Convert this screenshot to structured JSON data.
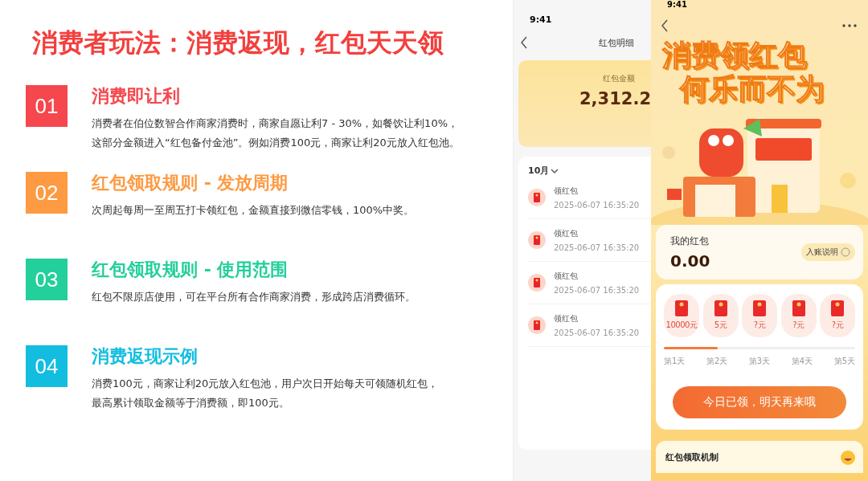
{
  "slide": {
    "title": "消费者玩法：消费返现，红包天天领",
    "points": [
      {
        "number": "01",
        "heading": "消费即让利",
        "color": "#f5474d",
        "body": [
          "消费者在伯位数智合作商家消费时，商家自愿让利7 - 30%，如餐饮让利10%，",
          "这部分金额进入“红包备付金池”。例如消费100元，商家让利20元放入红包池。"
        ]
      },
      {
        "number": "02",
        "heading": "红包领取规则 - 发放周期",
        "color": "#fd9a42",
        "body": [
          "次周起每周一至周五打卡领红包，金额直接到微信零钱，100%中奖。"
        ]
      },
      {
        "number": "03",
        "heading": "红包领取规则 - 使用范围",
        "color": "#23cf9a",
        "body": [
          "红包不限原店使用，可在平台所有合作商家消费，形成跨店消费循环。"
        ]
      },
      {
        "number": "04",
        "heading": "消费返现示例",
        "color": "#12bde0",
        "body": [
          "消费100元，商家让利20元放入红包池，用户次日开始每天可领随机红包，",
          "最高累计领取金额等于消费额，即100元。"
        ]
      }
    ]
  },
  "detail_phone": {
    "time": "9:41",
    "title": "红包明细",
    "balance_label": "红包金额",
    "balance": "2,312.2",
    "month": "10月",
    "records": [
      {
        "title": "领红包",
        "time": "2025-06-07 16:35:20"
      },
      {
        "title": "领红包",
        "time": "2025-06-07 16:35:20"
      },
      {
        "title": "领红包",
        "time": "2025-06-07 16:35:20"
      },
      {
        "title": "领红包",
        "time": "2025-06-07 16:35:20"
      }
    ]
  },
  "reward_phone": {
    "time": "9:41",
    "headline": [
      "消费领红包",
      "何乐而不为"
    ],
    "wallet_label": "我的红包",
    "wallet_amount": "0.00",
    "info_button": "入账说明",
    "rewards": [
      {
        "amount": "10000元",
        "day": "第1天"
      },
      {
        "amount": "5元",
        "day": "第2天"
      },
      {
        "amount": "?元",
        "day": "第3天"
      },
      {
        "amount": "?元",
        "day": "第4天"
      },
      {
        "amount": "?元",
        "day": "第5天"
      }
    ],
    "progress": {
      "level": 0.28
    },
    "button": "今日已领，明天再来哦",
    "section_title": "红包领取机制"
  }
}
